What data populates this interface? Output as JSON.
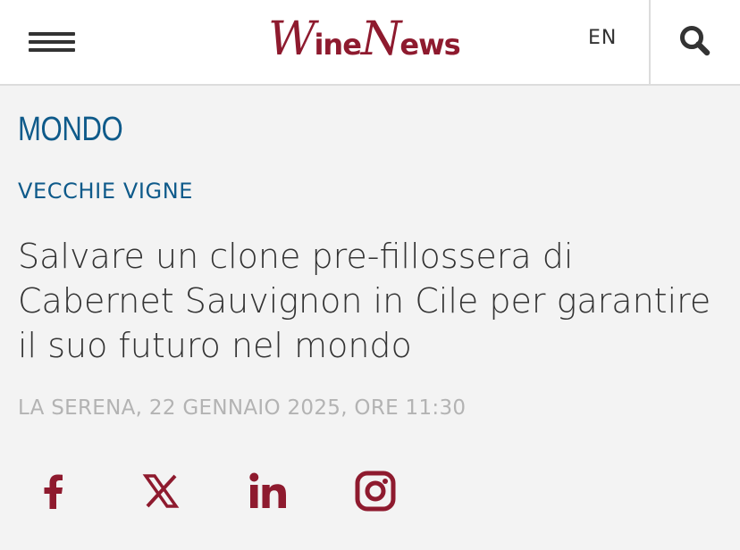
{
  "header": {
    "logo_main_1": "W",
    "logo_main_1b": "ine",
    "logo_main_2": "N",
    "logo_main_2b": "ews",
    "language": "EN",
    "icons": {
      "menu": "hamburger-icon",
      "search": "search-icon"
    }
  },
  "article": {
    "section": "MONDO",
    "category": "VECCHIE VIGNE",
    "title": "Salvare un clone pre-fillossera di Cabernet Sauvignon in Cile per garantire il suo futuro nel mondo",
    "dateline": "LA SERENA, 22 GENNAIO 2025, ORE 11:30"
  },
  "social": [
    "facebook-icon",
    "x-icon",
    "linkedin-icon",
    "instagram-icon"
  ],
  "colors": {
    "brand": "#8e1a2e",
    "accent_blue": "#0e5a8a",
    "text": "#333333",
    "muted": "#b3b3b3",
    "background": "#f3f3f3"
  }
}
